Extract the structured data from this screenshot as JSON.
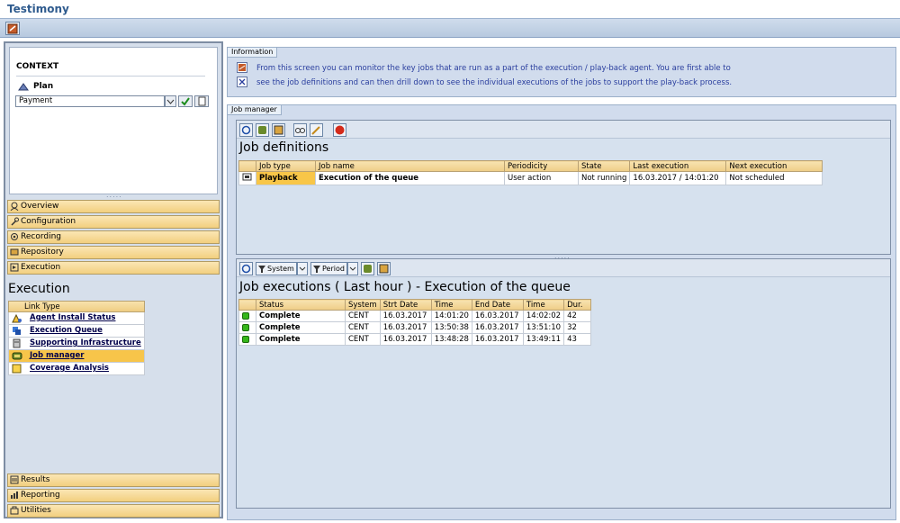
{
  "app": {
    "title": "Testimony"
  },
  "context": {
    "heading": "CONTEXT",
    "plan_label": "Plan",
    "plan_value": "Payment"
  },
  "nav": {
    "top_items": [
      "Overview",
      "Configuration",
      "Recording",
      "Repository",
      "Execution"
    ],
    "bottom_items": [
      "Results",
      "Reporting",
      "Utilities"
    ]
  },
  "execution": {
    "section_title": "Execution",
    "link_header": "Link Type",
    "links": [
      {
        "label": "Agent Install Status",
        "selected": false
      },
      {
        "label": "Execution Queue",
        "selected": false
      },
      {
        "label": "Supporting Infrastructure",
        "selected": false
      },
      {
        "label": "Job manager",
        "selected": true
      },
      {
        "label": "Coverage Analysis",
        "selected": false
      }
    ]
  },
  "information": {
    "group_label": "Information",
    "line1": "From this screen you can monitor the key jobs that are run as a part of the execution / play-back agent. You are first able to",
    "line2": "see the job definitions and can then drill down to see the individual executions of the jobs to support the play-back process."
  },
  "job_manager": {
    "group_label": "Job manager",
    "definitions": {
      "title": "Job definitions",
      "columns": [
        "Job type",
        "Job name",
        "Periodicity",
        "State",
        "Last execution",
        "Next execution"
      ],
      "rows": [
        [
          "Playback",
          "Execution of the queue",
          "User action",
          "Not running",
          "16.03.2017 / 14:01:20",
          "Not scheduled"
        ]
      ]
    },
    "executions": {
      "title": "Job executions ( Last hour ) - Execution of the queue",
      "system_btn": "System",
      "period_btn": "Period",
      "columns": [
        "Status",
        "System",
        "Strt Date",
        "Time",
        "End Date",
        "Time",
        "Dur."
      ],
      "rows": [
        [
          "Complete",
          "CENT",
          "16.03.2017",
          "14:01:20",
          "16.03.2017",
          "14:02:02",
          "42"
        ],
        [
          "Complete",
          "CENT",
          "16.03.2017",
          "13:50:38",
          "16.03.2017",
          "13:51:10",
          "32"
        ],
        [
          "Complete",
          "CENT",
          "16.03.2017",
          "13:48:28",
          "16.03.2017",
          "13:49:11",
          "43"
        ]
      ]
    }
  },
  "colors": {
    "accent": "#2f5b8e",
    "header_gold": "#f8c648",
    "status_green": "#35b61a",
    "panel_blue": "#d1dced"
  }
}
